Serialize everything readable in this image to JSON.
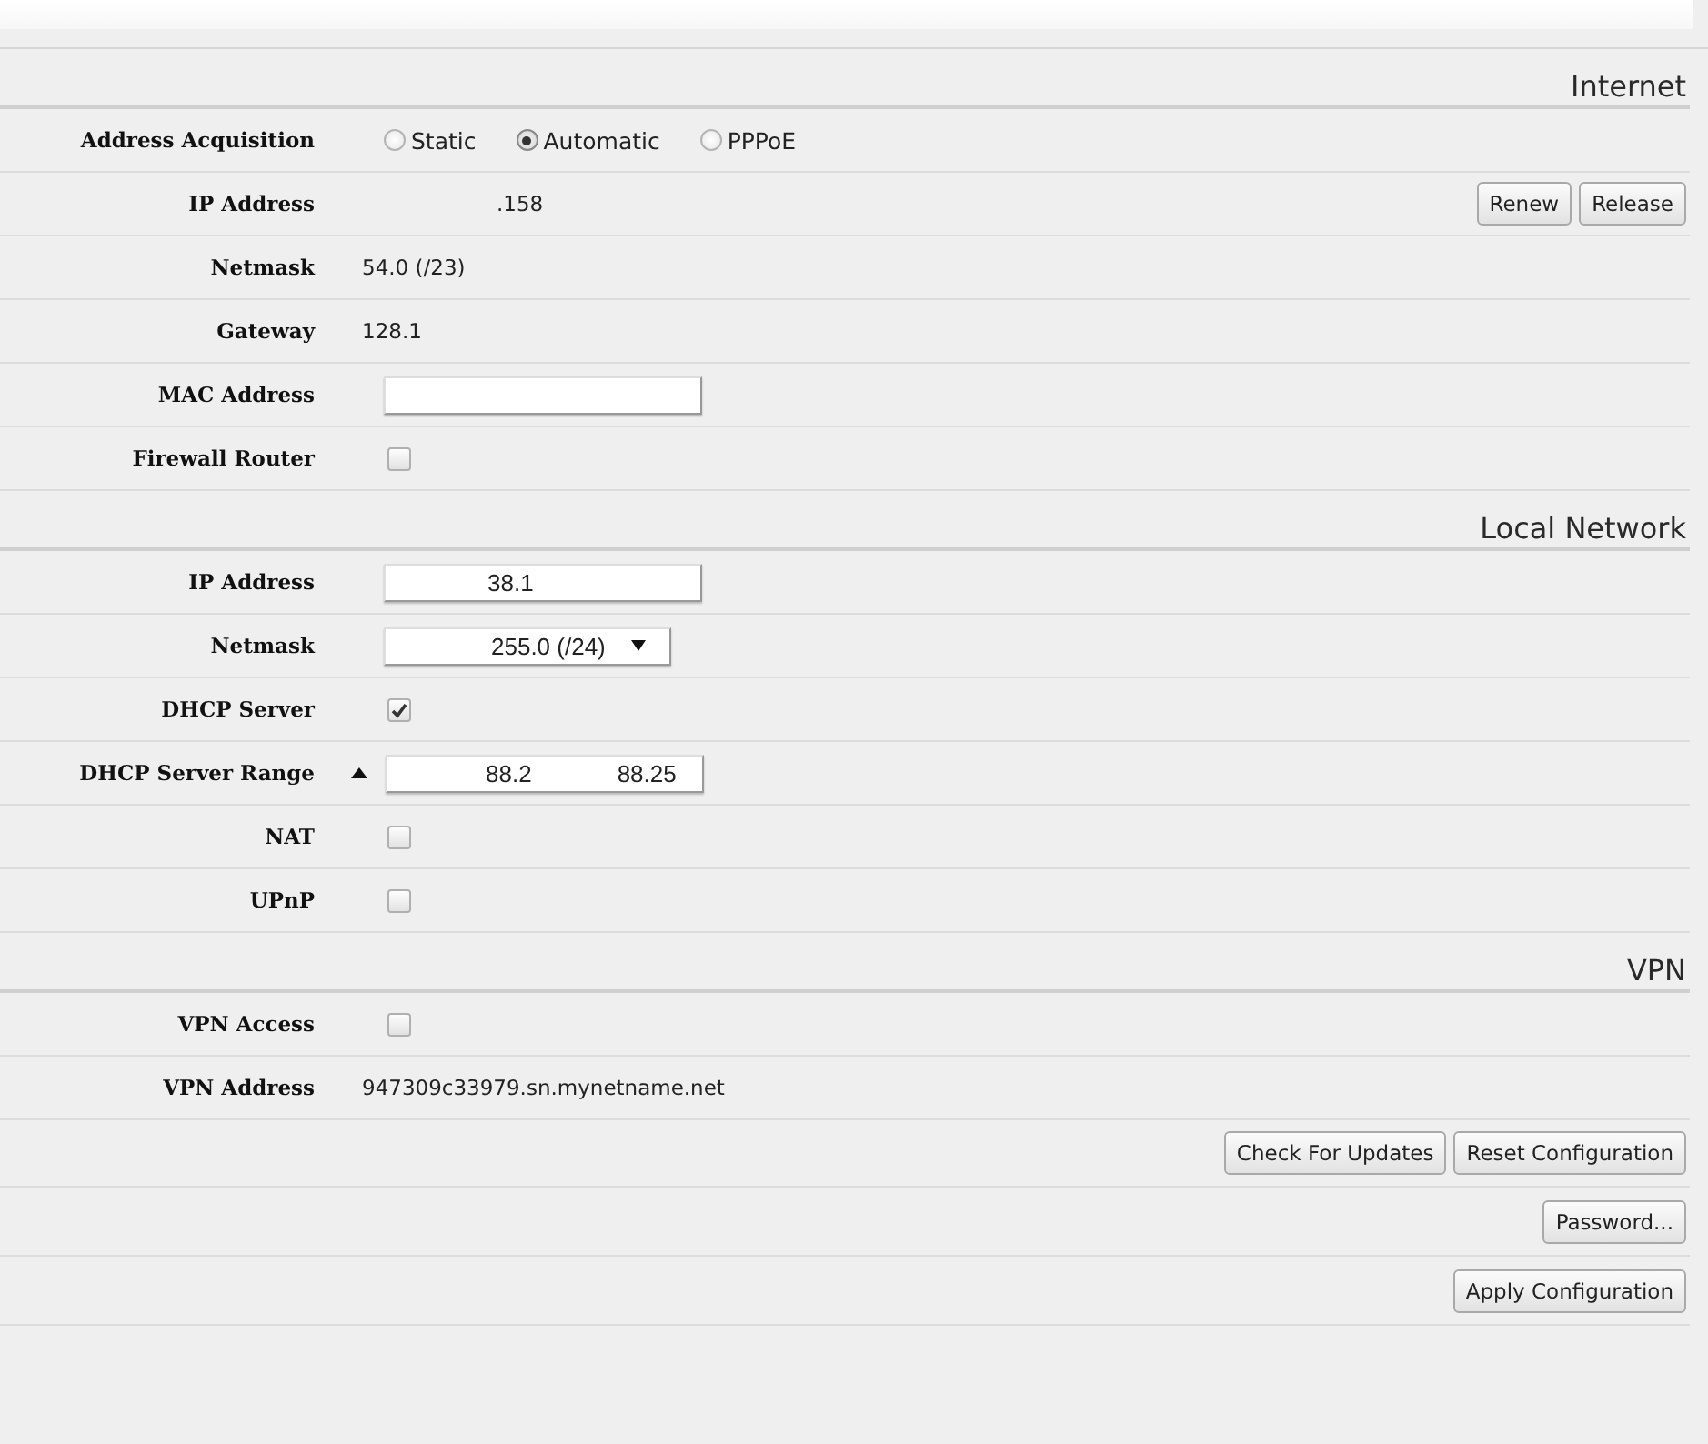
{
  "sections": [
    {
      "title": "Internet",
      "rows": [
        {
          "kind": "radio",
          "label": "Address Acquisition",
          "options": [
            {
              "label": "Static",
              "selected": false
            },
            {
              "label": "Automatic",
              "selected": true
            },
            {
              "label": "PPPoE",
              "selected": false
            }
          ]
        },
        {
          "kind": "text",
          "label": "IP Address",
          "value": ".158",
          "buttons": [
            "Renew",
            "Release"
          ]
        },
        {
          "kind": "text",
          "label": "Netmask",
          "value": "54.0 (/23)"
        },
        {
          "kind": "text",
          "label": "Gateway",
          "value": "128.1"
        },
        {
          "kind": "field",
          "label": "MAC Address"
        },
        {
          "kind": "checkbox",
          "label": "Firewall Router",
          "checked": false
        }
      ]
    },
    {
      "title": "Local Network",
      "rows": [
        {
          "kind": "field",
          "label": "IP Address",
          "value": "38.1"
        },
        {
          "kind": "select",
          "label": "Netmask",
          "value": "255.0 (/24)"
        },
        {
          "kind": "checkbox",
          "label": "DHCP Server",
          "checked": true
        },
        {
          "kind": "range",
          "label": "DHCP Server Range",
          "start": "88.2",
          "end": "88.25"
        },
        {
          "kind": "checkbox",
          "label": "NAT",
          "checked": false
        },
        {
          "kind": "checkbox",
          "label": "UPnP",
          "checked": false
        }
      ]
    },
    {
      "title": "VPN",
      "rows": [
        {
          "kind": "checkbox",
          "label": "VPN Access",
          "checked": false
        },
        {
          "kind": "text",
          "label": "VPN Address",
          "value": "947309c33979.sn.mynetname.net"
        }
      ]
    }
  ],
  "actions": [
    [
      "Check For Updates",
      "Reset Configuration"
    ],
    [
      "Password..."
    ],
    [
      "Apply Configuration"
    ]
  ]
}
